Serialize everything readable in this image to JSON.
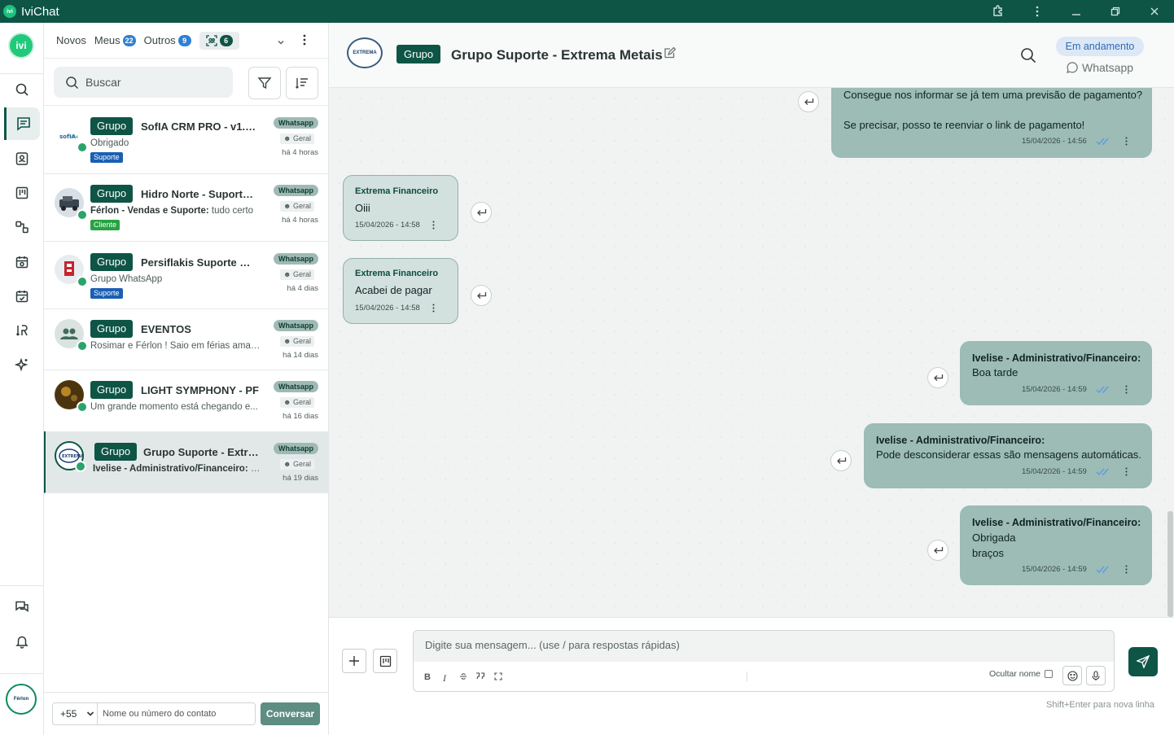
{
  "app": {
    "title": "IviChat",
    "logo_text": "ivi"
  },
  "rail": {
    "avatar_text": "ivi",
    "footer_logo_text": "Férlon"
  },
  "list": {
    "tabs": [
      {
        "label": "Novos"
      },
      {
        "label": "Meus",
        "count": "22"
      },
      {
        "label": "Outros",
        "count": "9"
      },
      {
        "label": "",
        "count": "6"
      }
    ],
    "search_placeholder": "Buscar",
    "conversations": [
      {
        "tag": "Grupo",
        "title": "SofIA CRM PRO - v1.6....",
        "subtitle_prefix": "",
        "subtitle": "Obrigado",
        "label": "Suporte",
        "label_color": "#1a5fb4",
        "channel": "Whatsapp",
        "queue": "Geral",
        "time": "há 4 horas"
      },
      {
        "tag": "Grupo",
        "title": "Hidro Norte - Suporte ...",
        "subtitle_prefix": "Férlon - Vendas e Suporte:",
        "subtitle": " tudo certo",
        "label": "Cliente",
        "label_color": "#27a243",
        "channel": "Whatsapp",
        "queue": "Geral",
        "time": "há 4 horas"
      },
      {
        "tag": "Grupo",
        "title": "Persiflakis Suporte Ma...",
        "subtitle_prefix": "",
        "subtitle": "Grupo WhatsApp",
        "label": "Suporte",
        "label_color": "#1a5fb4",
        "channel": "Whatsapp",
        "queue": "Geral",
        "time": "há 4 dias"
      },
      {
        "tag": "Grupo",
        "title": "EVENTOS",
        "subtitle_prefix": "",
        "subtitle": "Rosimar e Férlon ! Saio em férias aman...",
        "label": "",
        "label_color": "",
        "channel": "Whatsapp",
        "queue": "Geral",
        "time": "há 14 dias"
      },
      {
        "tag": "Grupo",
        "title": "LIGHT SYMPHONY - PF",
        "subtitle_prefix": "",
        "subtitle": "Um grande momento está chegando e...",
        "label": "",
        "label_color": "",
        "channel": "Whatsapp",
        "queue": "Geral",
        "time": "há 16 dias"
      },
      {
        "tag": "Grupo",
        "title": "Grupo Suporte - Extre...",
        "subtitle_prefix": "Ivelise - Administrativo/Financeiro:",
        "subtitle": " O...",
        "label": "",
        "label_color": "",
        "channel": "Whatsapp",
        "queue": "Geral",
        "time": "há 19 dias"
      }
    ],
    "country_code": "+55",
    "number_placeholder": "Nome ou número do contato",
    "start_button": "Conversar"
  },
  "chat": {
    "tag": "Grupo",
    "title": "Grupo Suporte - Extrema Metais",
    "header_logo_text": "EXTREMA",
    "status": "Em andamento",
    "channel": "Whatsapp",
    "messages": [
      {
        "dir": "out",
        "sender": "",
        "lines": [
          "Consegue nos informar se já tem uma previsão de pagamento?",
          "",
          "Se precisar, posso te reenviar o link de pagamento!"
        ],
        "time": "15/04/2026 - 14:56"
      },
      {
        "dir": "in",
        "sender": "Extrema Financeiro",
        "lines": [
          "Oiii"
        ],
        "time": "15/04/2026 - 14:58"
      },
      {
        "dir": "in",
        "sender": "Extrema Financeiro",
        "lines": [
          "Acabei de pagar"
        ],
        "time": "15/04/2026 - 14:58"
      },
      {
        "dir": "out",
        "sender": "Ivelise - Administrativo/Financeiro:",
        "lines": [
          "Boa tarde"
        ],
        "time": "15/04/2026 - 14:59"
      },
      {
        "dir": "out",
        "sender": "Ivelise - Administrativo/Financeiro:",
        "lines": [
          "Pode desconsiderar essas são mensagens automáticas."
        ],
        "time": "15/04/2026 - 14:59"
      },
      {
        "dir": "out",
        "sender": "Ivelise - Administrativo/Financeiro:",
        "lines": [
          "Obrigada",
          "braços"
        ],
        "time": "15/04/2026 - 14:59"
      }
    ]
  },
  "composer": {
    "placeholder": "Digite sua mensagem... (use / para respostas rápidas)",
    "hide_name_label": "Ocultar nome",
    "hint": "Shift+Enter para nova linha",
    "format_bold": "B",
    "format_italic": "I"
  },
  "colors": {
    "brand": "#0e5546",
    "accent_blue": "#2f80d1",
    "bubble_out": "#9cbcb5",
    "bubble_in": "#d2e0de"
  }
}
